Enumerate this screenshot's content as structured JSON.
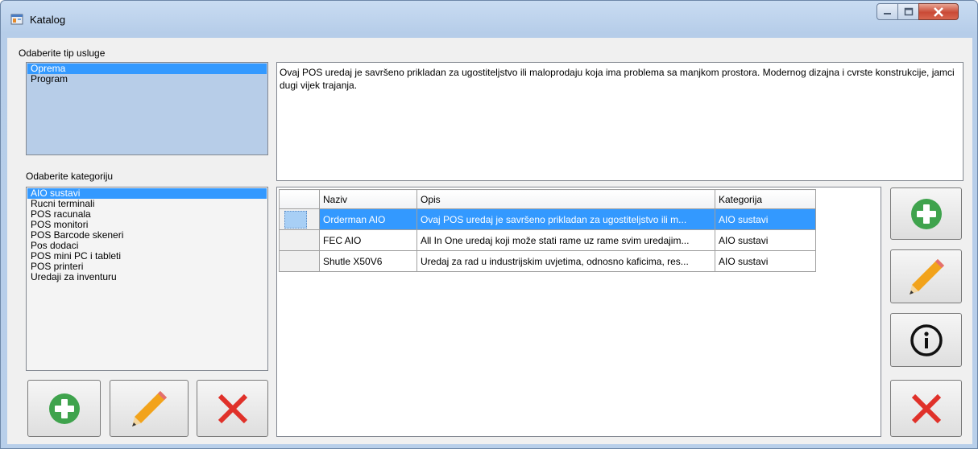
{
  "window": {
    "title": "Katalog",
    "icon": "app-window-icon",
    "controls": [
      "minimize-icon",
      "maximize-icon",
      "close-icon"
    ]
  },
  "service_type": {
    "label": "Odaberite tip usluge",
    "items": [
      "Oprema",
      "Program"
    ],
    "selected": "Oprema"
  },
  "category": {
    "label": "Odaberite kategoriju",
    "items": [
      "AIO sustavi",
      "Rucni terminali",
      "POS racunala",
      "POS monitori",
      "POS Barcode skeneri",
      "Pos dodaci",
      "POS mini PC i tableti",
      "POS printeri",
      "Uredaji za inventuru"
    ],
    "selected": "AIO sustavi"
  },
  "description": "Ovaj POS uredaj je savršeno prikladan za ugostiteljstvo ili maloprodaju koja ima problema sa manjkom prostora. Modernog dizajna i cvrste konstrukcije, jamci dugi vijek trajanja.",
  "grid": {
    "columns": [
      "Naziv",
      "Opis",
      "Kategorija"
    ],
    "rows": [
      {
        "naziv": "Orderman AIO",
        "opis": "Ovaj POS uredaj je savršeno prikladan za ugostiteljstvo ili m...",
        "kategorija": "AIO sustavi"
      },
      {
        "naziv": "FEC AIO",
        "opis": "All In One uredaj koji može stati rame uz rame svim uredajim...",
        "kategorija": "AIO sustavi"
      },
      {
        "naziv": "Shutle X50V6",
        "opis": "Uredaj za rad u industrijskim uvjetima, odnosno kaficima, res...",
        "kategorija": "AIO sustavi"
      }
    ],
    "selected_row": 0
  },
  "category_actions": [
    "add-icon",
    "edit-pencil-icon",
    "delete-x-icon"
  ],
  "product_actions": [
    "add-icon",
    "edit-pencil-icon",
    "info-icon",
    "delete-x-icon"
  ],
  "colors": {
    "add_green": "#3fa34d",
    "pencil_orange": "#f2a31b",
    "delete_red": "#e0312a",
    "selection_blue": "#3399ff"
  }
}
